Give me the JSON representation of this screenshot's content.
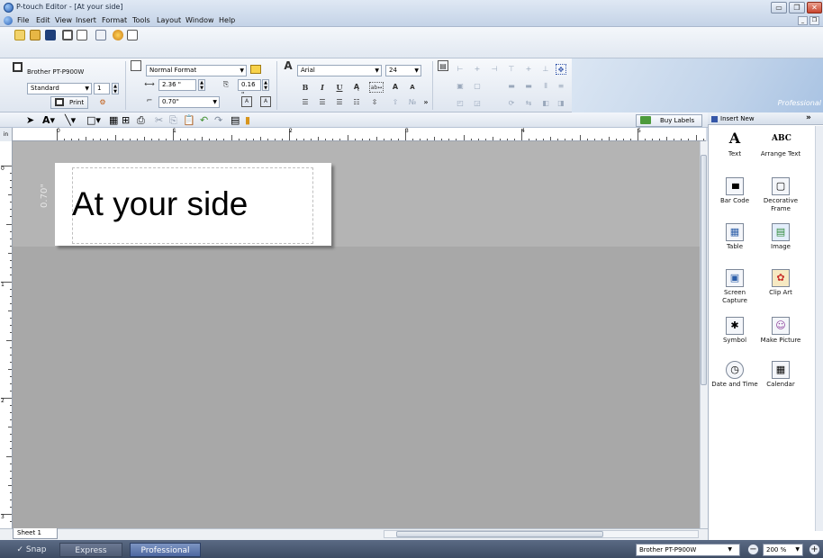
{
  "window": {
    "title": "P-touch Editor - [At your side]",
    "min_glyph": "▭",
    "max_glyph": "❐",
    "close_glyph": "✕",
    "mdi_min": "_",
    "mdi_restore": "❐"
  },
  "menu": [
    "File",
    "Edit",
    "View",
    "Insert",
    "Format",
    "Tools",
    "Layout",
    "Window",
    "Help"
  ],
  "ribbon": {
    "printer": "Brother PT-P900W",
    "quality": "Standard",
    "copies": "1",
    "print_label": "Print",
    "format": "Normal Format",
    "width": "2.36 \"",
    "margin": "0.16 \"",
    "length": "0.70\"",
    "font": "Arial",
    "font_size": "24",
    "bold": "B",
    "italic": "I",
    "underline": "U",
    "brand": "Professional",
    "more": "»"
  },
  "buy_labels": "Buy Labels",
  "ruler": {
    "unit": "in",
    "marks": [
      "0",
      "1",
      "2",
      "3",
      "4",
      "5"
    ],
    "vmarks": [
      "0",
      "1",
      "2",
      "3"
    ]
  },
  "label": {
    "text": "At your side",
    "length": "0.70\""
  },
  "sheet_tab": "Sheet 1",
  "side_panel": {
    "title": "Insert New",
    "more": "»",
    "items": [
      {
        "label": "Text",
        "icon": "text-icon",
        "glyph": "A"
      },
      {
        "label": "Arrange Text",
        "icon": "arrange-text-icon",
        "glyph": "ABC"
      },
      {
        "label": "Bar Code",
        "icon": "barcode-icon",
        "glyph": "▮▮▮"
      },
      {
        "label": "Decorative Frame",
        "icon": "frame-icon",
        "glyph": "▢"
      },
      {
        "label": "Table",
        "icon": "table-icon",
        "glyph": "▦"
      },
      {
        "label": "Image",
        "icon": "image-icon",
        "glyph": "▤"
      },
      {
        "label": "Screen Capture",
        "icon": "screen-capture-icon",
        "glyph": "▣"
      },
      {
        "label": "Clip Art",
        "icon": "clipart-icon",
        "glyph": "✿"
      },
      {
        "label": "Symbol",
        "icon": "symbol-icon",
        "glyph": "✱"
      },
      {
        "label": "Make Picture",
        "icon": "make-picture-icon",
        "glyph": "☺"
      },
      {
        "label": "Date and Time",
        "icon": "date-time-icon",
        "glyph": "◷"
      },
      {
        "label": "Calendar",
        "icon": "calendar-icon",
        "glyph": "▦"
      }
    ]
  },
  "status": {
    "snap": "Snap",
    "express": "Express",
    "professional": "Professional",
    "printer": "Brother PT-P900W",
    "zoom": "200 %",
    "zoom_out": "−",
    "zoom_in": "+"
  }
}
